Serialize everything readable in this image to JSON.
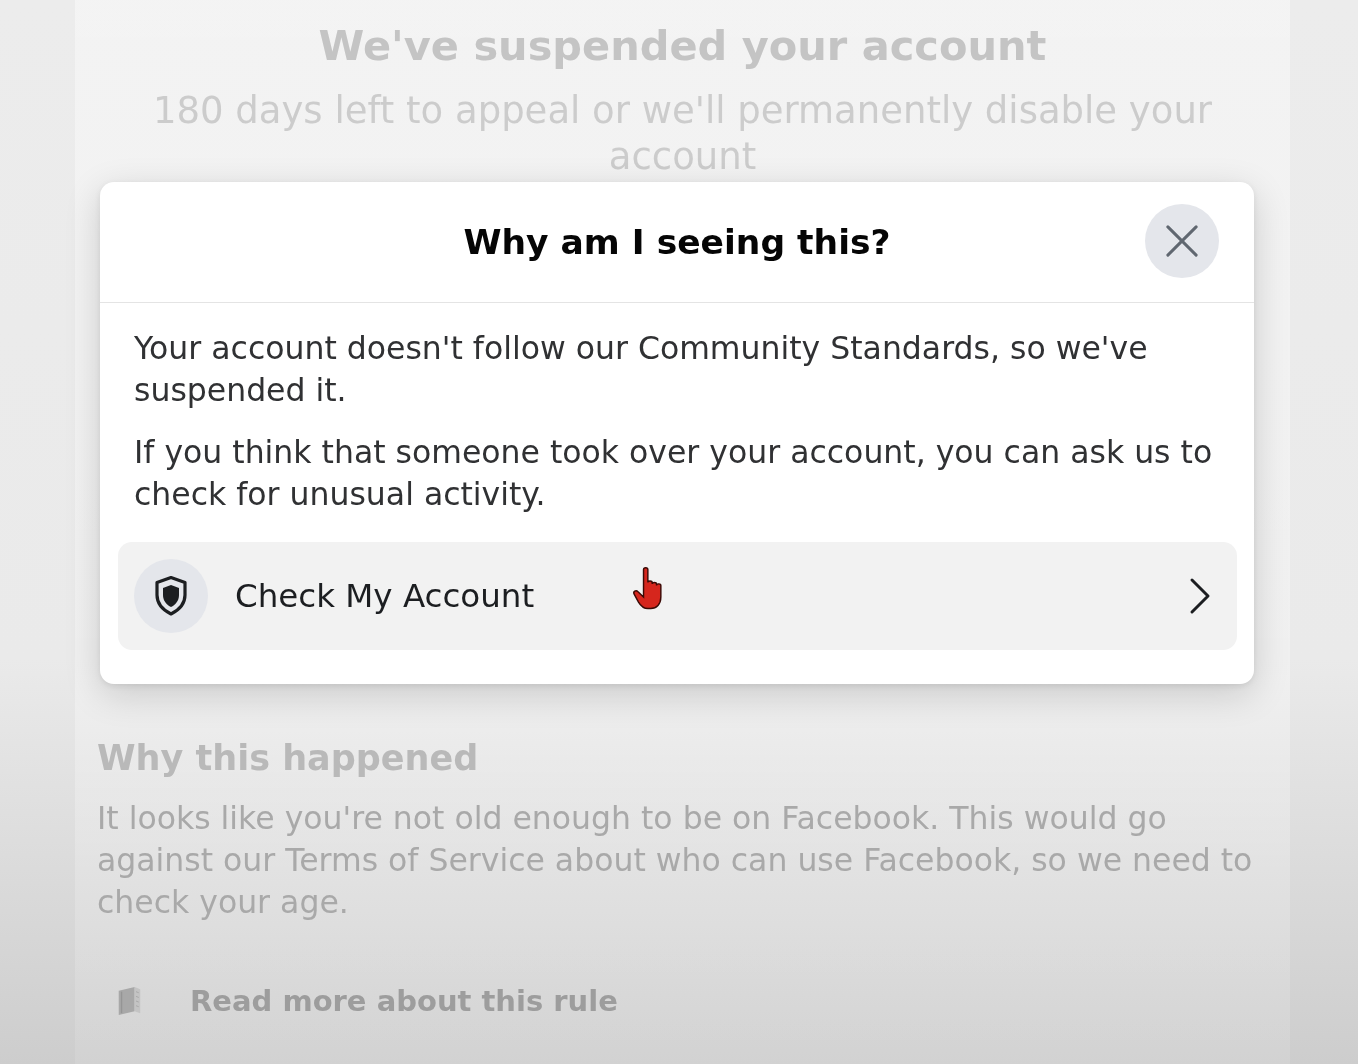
{
  "page": {
    "title": "We've suspended your account",
    "subtitle": "180 days left to appeal or we'll permanently disable your account",
    "section": {
      "heading": "Why this happened",
      "text": "It looks like you're not old enough to be on Facebook. This would go against our Terms of Service about who can use Facebook, so we need to check your age.",
      "link": "Read more about this rule"
    }
  },
  "dialog": {
    "title": "Why am I seeing this?",
    "paragraphs": [
      "Your account doesn't follow our Community Standards, so we've suspended it.",
      "If you think that someone took over your account, you can ask us to check for unusual activity."
    ],
    "action": {
      "label": "Check My Account"
    }
  }
}
